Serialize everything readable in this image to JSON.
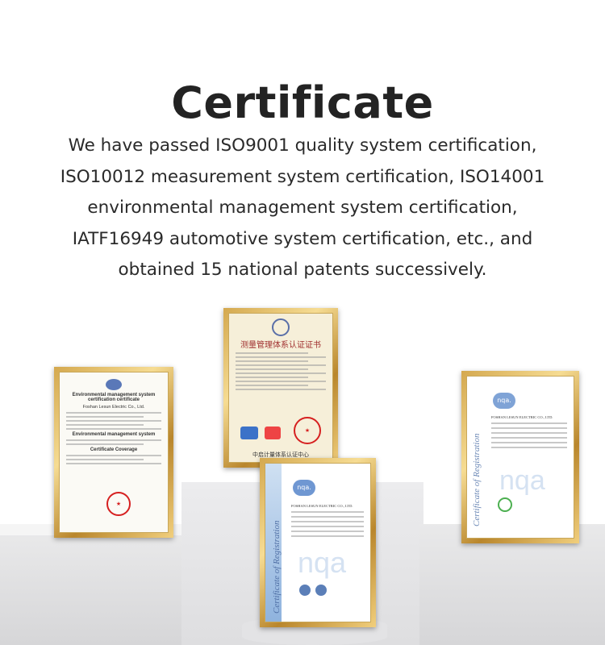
{
  "title": "Certificate",
  "description_lines": [
    "We have passed ISO9001 quality system certification,",
    "ISO10012 measurement system certification, ISO14001",
    "environmental management system certification,",
    "IATF16949 automotive system certification, etc., and",
    "obtained 15 national patents successively."
  ],
  "certificates": {
    "env": {
      "heading": "Environmental management system certification certificate",
      "company": "Foshan Lesun Electric Co., Ltd.",
      "section1": "Environmental management system",
      "section2": "Certificate Coverage"
    },
    "measure": {
      "heading": "测量管理体系认证证书",
      "footer": "中启计量体系认证中心"
    },
    "nqa_front": {
      "brand": "nqa.",
      "vertical": "Certificate of Registration",
      "company": "FOSHAN LESUN ELECTRIC CO., LTD."
    },
    "nqa_right": {
      "brand": "nqa.",
      "vertical": "Certificate of Registration",
      "company": "FOSHAN LESUN ELECTRIC CO., LTD."
    }
  },
  "colors": {
    "frame_gold": "#d4a84e",
    "seal_red": "#d62020",
    "nqa_blue": "#6a87b5"
  }
}
